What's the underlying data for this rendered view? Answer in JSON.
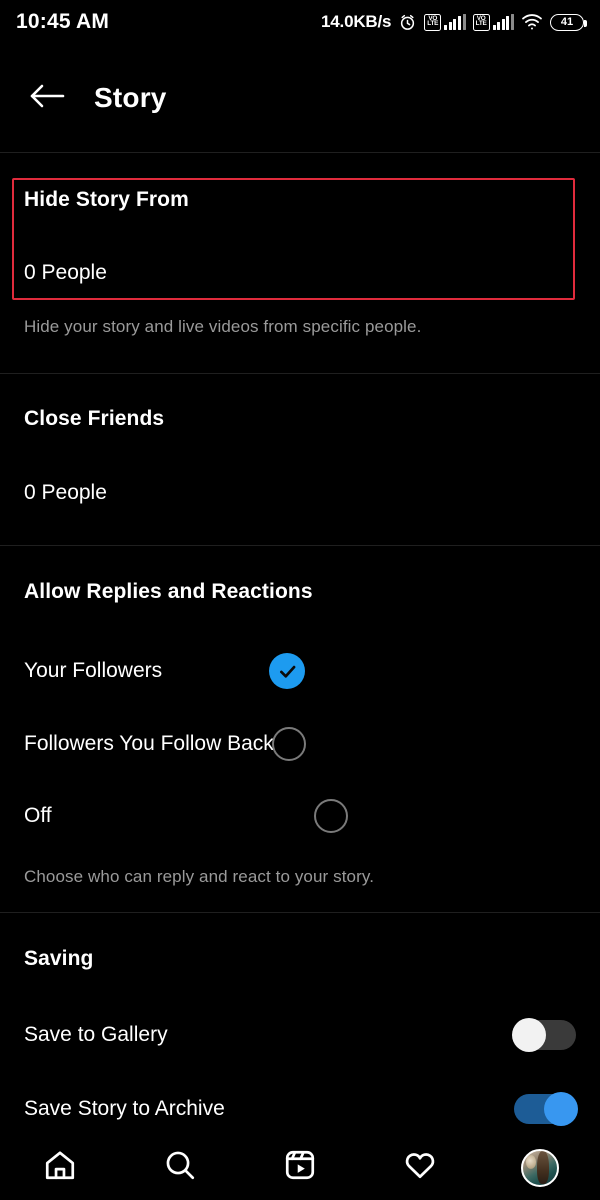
{
  "status_bar": {
    "time": "10:45 AM",
    "network_speed": "14.0KB/s",
    "alarm_icon": "alarm-clock-icon",
    "volte_label_top": "VO",
    "volte_label_bottom": "LTE",
    "wifi_icon": "wifi-icon",
    "battery_level": "41"
  },
  "header": {
    "back_icon": "back-arrow-icon",
    "title": "Story"
  },
  "sections": {
    "hide_story": {
      "title": "Hide Story From",
      "value": "0 People",
      "description": "Hide your story and live videos from specific people.",
      "highlighted": true,
      "highlight_color": "#e02b3c"
    },
    "close_friends": {
      "title": "Close Friends",
      "value": "0 People"
    },
    "allow_replies": {
      "title": "Allow Replies and Reactions",
      "description": "Choose who can reply and react to your story.",
      "options": [
        {
          "label": "Your Followers",
          "selected": true
        },
        {
          "label": "Followers You Follow Back",
          "selected": false
        },
        {
          "label": "Off",
          "selected": false
        }
      ]
    },
    "saving": {
      "title": "Saving",
      "toggles": [
        {
          "label": "Save to Gallery",
          "on": false
        },
        {
          "label": "Save Story to Archive",
          "on": true
        }
      ]
    }
  },
  "bottom_nav": {
    "items": [
      {
        "icon": "home-icon"
      },
      {
        "icon": "search-icon"
      },
      {
        "icon": "reels-icon"
      },
      {
        "icon": "heart-icon"
      },
      {
        "icon": "profile-avatar"
      }
    ]
  },
  "colors": {
    "accent_blue": "#1d9bf0",
    "toggle_on": "#3897f0",
    "highlight_red": "#e02b3c",
    "muted_text": "#9a9a9a",
    "background": "#000000"
  }
}
